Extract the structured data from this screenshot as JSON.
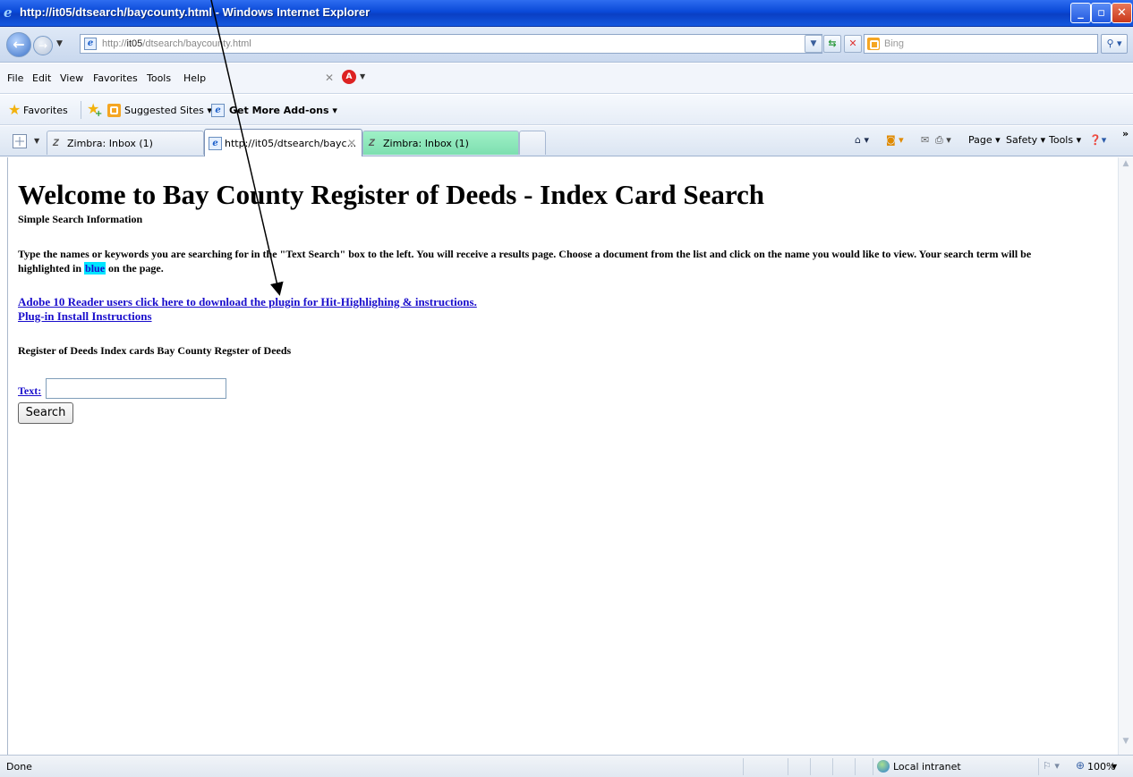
{
  "window": {
    "title": "http://it05/dtsearch/baycounty.html - Windows Internet Explorer"
  },
  "address_bar": {
    "url_prefix": "http://",
    "url_host": "it05",
    "url_path": "/dtsearch/baycounty.html"
  },
  "search_box": {
    "placeholder": "Bing"
  },
  "menu": {
    "items": [
      "File",
      "Edit",
      "View",
      "Favorites",
      "Tools",
      "Help"
    ]
  },
  "favorites_bar": {
    "favorites_label": "Favorites",
    "items": [
      "Suggested Sites ▾",
      "Get More Add-ons ▾"
    ]
  },
  "tabs": [
    {
      "label": "Zimbra: Inbox (1)",
      "active": false
    },
    {
      "label": "http://it05/dtsearch/bayc...",
      "active": true
    },
    {
      "label": "Zimbra: Inbox (1)",
      "active": false
    }
  ],
  "command_bar": {
    "items": [
      "Page ▾",
      "Safety ▾",
      "Tools ▾"
    ],
    "overflow": "»"
  },
  "page": {
    "heading": "Welcome to Bay County Register of Deeds - Index Card Search",
    "subheading": "Simple Search Information",
    "instructions_line1": "Type the names or keywords you are searching for in the \"Text Search\" box to the left. You will receive a results page. Choose a document from the list and click on the name you would like to view. Your search term will be",
    "instructions_line2_pre": "highlighted in ",
    "instructions_highlight": "blue",
    "instructions_line2_post": " on the page.",
    "link_plugin": "Adobe 10 Reader users click here to download the plugin for Hit-Highlighing & instructions.",
    "link_install": "Plug-in Install Instructions",
    "index_text": "Register of Deeds Index cards Bay County Regster of Deeds",
    "text_label": "Text:",
    "text_value": "",
    "search_button": "Search"
  },
  "status_bar": {
    "status": "Done",
    "zone": "Local intranet",
    "zoom": "100%"
  },
  "colors": {
    "highlight": "#00e5ff",
    "link": "#1a0ecc",
    "titlebar": "#0a49d8"
  }
}
